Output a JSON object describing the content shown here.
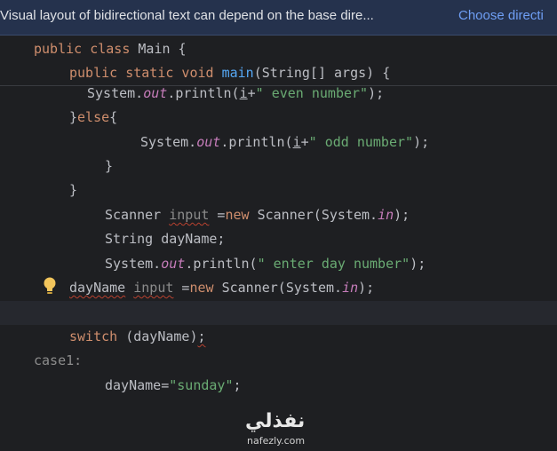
{
  "banner": {
    "message": "Visual layout of bidirectional text can depend on the base dire...",
    "link": "Choose directi"
  },
  "code": {
    "l1": {
      "kw": "public class ",
      "name": "Main {"
    },
    "l2": {
      "kw": "public static void ",
      "fn": "main",
      "rest": "(String[] args) {"
    },
    "l3": {
      "a": "System.",
      "b": "out",
      "c": ".println(",
      "d": "i",
      "e": "+",
      "f": "\" even number\"",
      "g": ");"
    },
    "l4": {
      "a": "}",
      "b": "else",
      "c": "{"
    },
    "l5": {
      "a": "System.",
      "b": "out",
      "c": ".println(",
      "d": "i",
      "e": "+",
      "f": "\" odd number\"",
      "g": ");"
    },
    "l6": "}",
    "l7": "}",
    "l8": {
      "a": "Scanner ",
      "b": "input",
      "c": " =",
      "d": "new",
      "e": " Scanner(System.",
      "f": "in",
      "g": ");"
    },
    "l9": "String dayName;",
    "l10": {
      "a": "System.",
      "b": "out",
      "c": ".println(",
      "d": "\" enter day number\"",
      "e": ");"
    },
    "l11": {
      "a": "dayName",
      "b": " ",
      "c": "input",
      "d": " =",
      "e": "new",
      "f": " Scanner(System.",
      "g": "in",
      "h": ");"
    },
    "l12": {
      "a": "switch",
      "b": " (dayName)",
      "c": ";"
    },
    "l13": "case1:",
    "l14": {
      "a": "dayName=",
      "b": "\"sunday\"",
      "c": ";"
    }
  },
  "watermark": {
    "arabic": "نفذلي",
    "latin": "nafezly.com"
  }
}
